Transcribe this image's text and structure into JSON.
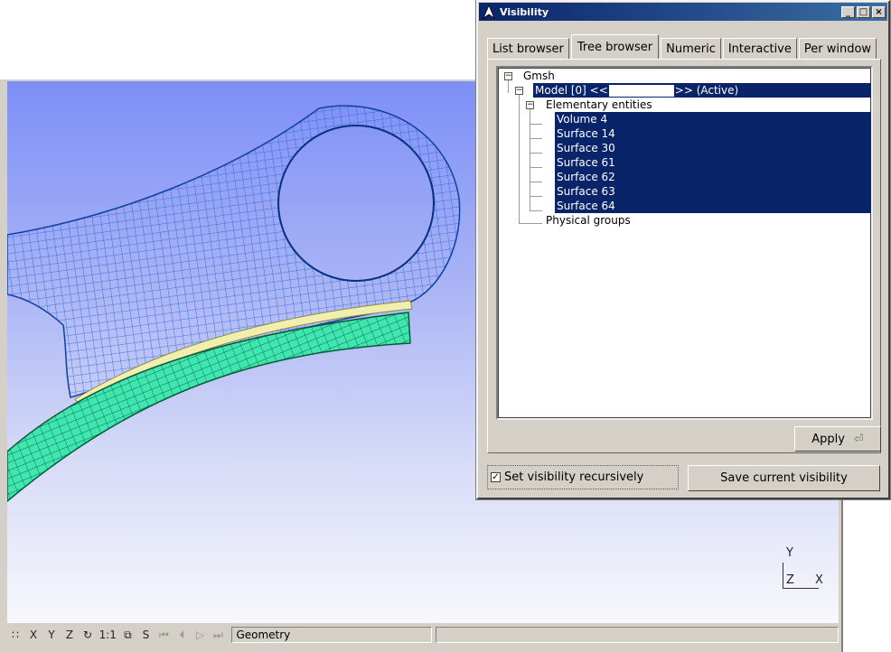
{
  "viewport": {
    "axes": {
      "y": "Y",
      "z": "Z",
      "x": "X"
    }
  },
  "statusbar": {
    "buttons": [
      {
        "label": "∷",
        "icon": "grid-icon"
      },
      {
        "label": "X"
      },
      {
        "label": "Y"
      },
      {
        "label": "Z"
      },
      {
        "label": "↻",
        "icon": "rotate-icon"
      },
      {
        "label": "1:1"
      },
      {
        "label": "⧉",
        "icon": "projection-icon"
      },
      {
        "label": "S"
      },
      {
        "label": "⏮",
        "icon": "first-icon"
      },
      {
        "label": "⏴",
        "icon": "previous-icon"
      },
      {
        "label": "▷",
        "icon": "play-icon"
      },
      {
        "label": "⏭",
        "icon": "last-icon"
      }
    ],
    "module": "Geometry",
    "message": ""
  },
  "dialog": {
    "title": "Visibility",
    "tabs": [
      {
        "label": "List browser",
        "active": false
      },
      {
        "label": "Tree browser",
        "active": true
      },
      {
        "label": "Numeric",
        "active": false
      },
      {
        "label": "Interactive",
        "active": false
      },
      {
        "label": "Per window",
        "active": false
      }
    ],
    "tree": {
      "root": "Gmsh",
      "model_prefix": "Model [0] <<",
      "model_name": "",
      "model_suffix": ">> (Active)",
      "elementary": "Elementary entities",
      "entities": [
        "Volume 4",
        "Surface 14",
        "Surface 30",
        "Surface 61",
        "Surface 62",
        "Surface 63",
        "Surface 64"
      ],
      "physical": "Physical groups"
    },
    "apply_label": "Apply",
    "recursive_label": "Set visibility recursively",
    "recursive_checked": true,
    "save_label": "Save current visibility"
  },
  "colors": {
    "selection": "#0a246a",
    "mesh_blue": "#1f5fd8",
    "mesh_green": "#3fe0b0"
  }
}
